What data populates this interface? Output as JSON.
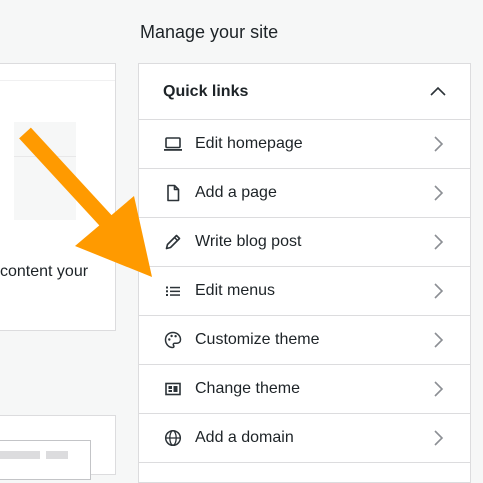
{
  "left": {
    "snippet": "content your"
  },
  "section_title": "Manage your site",
  "quick_links": {
    "title": "Quick links",
    "items": [
      {
        "label": "Edit homepage",
        "icon": "laptop-icon"
      },
      {
        "label": "Add a page",
        "icon": "page-icon"
      },
      {
        "label": "Write blog post",
        "icon": "pencil-icon"
      },
      {
        "label": "Edit menus",
        "icon": "menu-list-icon"
      },
      {
        "label": "Customize theme",
        "icon": "palette-icon"
      },
      {
        "label": "Change theme",
        "icon": "theme-layout-icon"
      },
      {
        "label": "Add a domain",
        "icon": "globe-icon"
      }
    ]
  },
  "colors": {
    "annotation_arrow": "#ff9a00",
    "text": "#1d2327",
    "icon": "#2c3338",
    "chevron": "#8c8f94",
    "border": "#dcdcde",
    "page_background": "#f6f7f7"
  }
}
